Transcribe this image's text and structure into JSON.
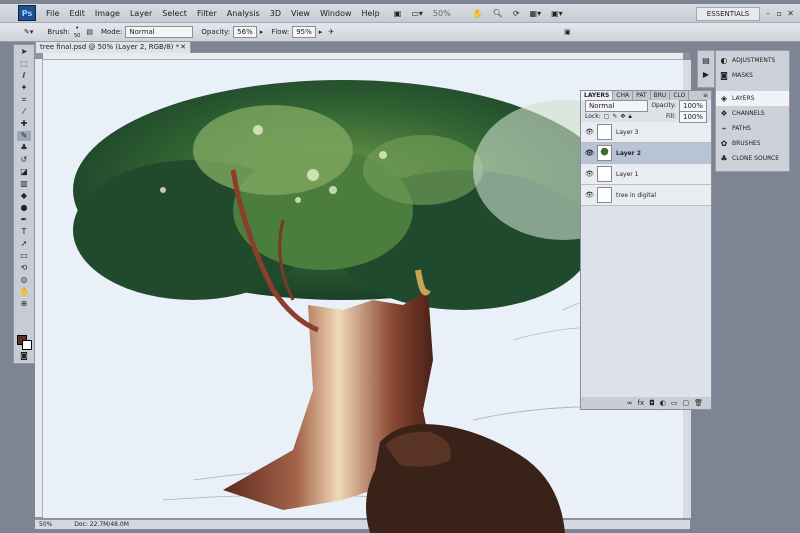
{
  "app": {
    "logo": "Ps",
    "menu": [
      "File",
      "Edit",
      "Image",
      "Layer",
      "Select",
      "Filter",
      "Analysis",
      "3D",
      "View",
      "Window",
      "Help"
    ],
    "zoom": "50%",
    "workspace": "ESSENTIALS"
  },
  "options_bar": {
    "brush_label": "Brush:",
    "brush_size": "50",
    "mode_label": "Mode:",
    "mode_value": "Normal",
    "opacity_label": "Opacity:",
    "opacity_value": "56%",
    "flow_label": "Flow:",
    "flow_value": "95%"
  },
  "document": {
    "tab_title": "tree final.psd @ 50% (Layer 2, RGB/8) *",
    "status_zoom": "50%",
    "status_doc": "Doc: 22.7M/48.0M"
  },
  "dock": {
    "items": [
      {
        "label": "ADJUSTMENTS",
        "icon": "adjustments-icon"
      },
      {
        "label": "MASKS",
        "icon": "masks-icon"
      },
      {
        "label": "LAYERS",
        "icon": "layers-icon",
        "active": true
      },
      {
        "label": "CHANNELS",
        "icon": "channels-icon"
      },
      {
        "label": "PATHS",
        "icon": "paths-icon"
      },
      {
        "label": "BRUSHES",
        "icon": "brushes-icon"
      },
      {
        "label": "CLONE SOURCE",
        "icon": "clone-source-icon"
      }
    ]
  },
  "layers_panel": {
    "tabs": [
      "LAYERS",
      "CHA",
      "PAT",
      "BRU",
      "CLO"
    ],
    "blend_mode": "Normal",
    "opacity_label": "Opacity:",
    "opacity_value": "100%",
    "lock_label": "Lock:",
    "fill_label": "Fill:",
    "fill_value": "100%",
    "layers": [
      {
        "name": "Layer 3",
        "selected": false
      },
      {
        "name": "Layer 2",
        "selected": true
      },
      {
        "name": "Layer 1",
        "selected": false
      },
      {
        "name": "tree in digital",
        "selected": false
      }
    ]
  }
}
